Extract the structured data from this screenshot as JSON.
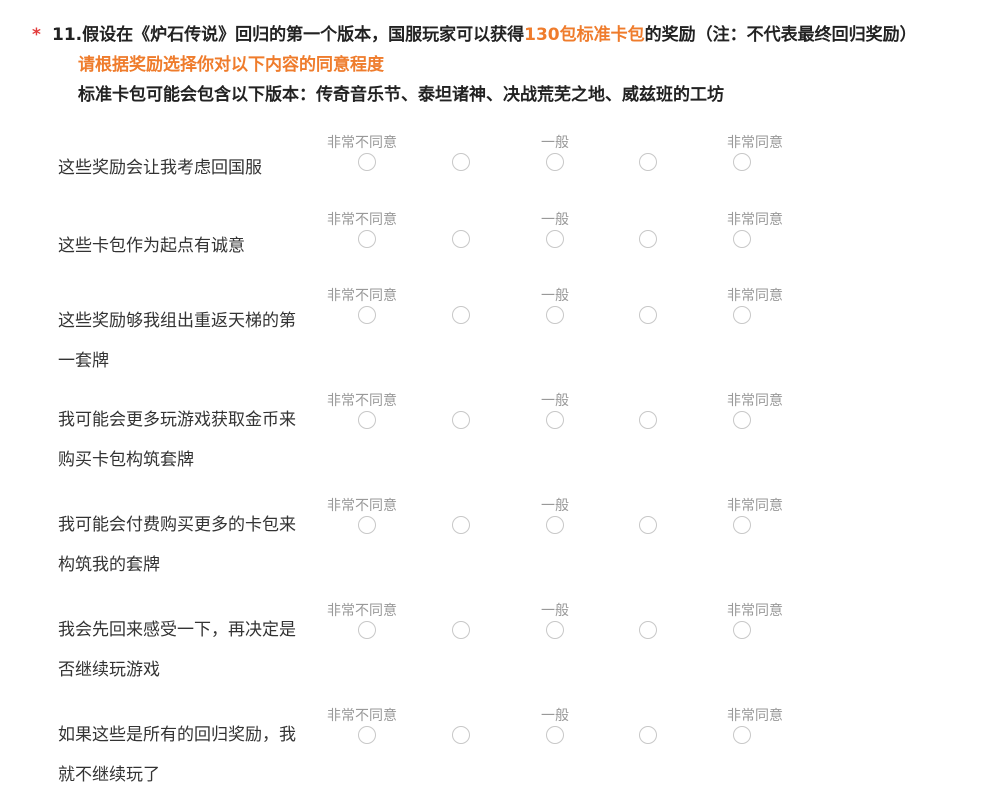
{
  "question": {
    "required_mark": "*",
    "line1_prefix": "11.假设在《炉石传说》回归的第一个版本，国服玩家可以获得",
    "line1_highlight": "130包标准卡包",
    "line1_suffix": "的奖励（注：不代表最终回归奖励）",
    "line2": "请根据奖励选择你对以下内容的同意程度",
    "line3": "标准卡包可能会包含以下版本：传奇音乐节、泰坦诸神、决战荒芜之地、威兹班的工坊"
  },
  "scale": {
    "left_label": "非常不同意",
    "mid_label": "一般",
    "right_label": "非常同意",
    "point_count": 5
  },
  "rows": [
    {
      "label": "这些奖励会让我考虑回国服"
    },
    {
      "label": "这些卡包作为起点有诚意"
    },
    {
      "label": "这些奖励够我组出重返天梯的第一套牌"
    },
    {
      "label": "我可能会更多玩游戏获取金币来购买卡包构筑套牌"
    },
    {
      "label": "我可能会付费购买更多的卡包来构筑我的套牌"
    },
    {
      "label": "我会先回来感受一下，再决定是否继续玩游戏"
    },
    {
      "label": "如果这些是所有的回归奖励，我就不继续玩了"
    }
  ],
  "colors": {
    "accent": "#ef7c2c",
    "required": "#e23b3b",
    "scale_text": "#999999",
    "radio_border": "#c8c8c8"
  }
}
